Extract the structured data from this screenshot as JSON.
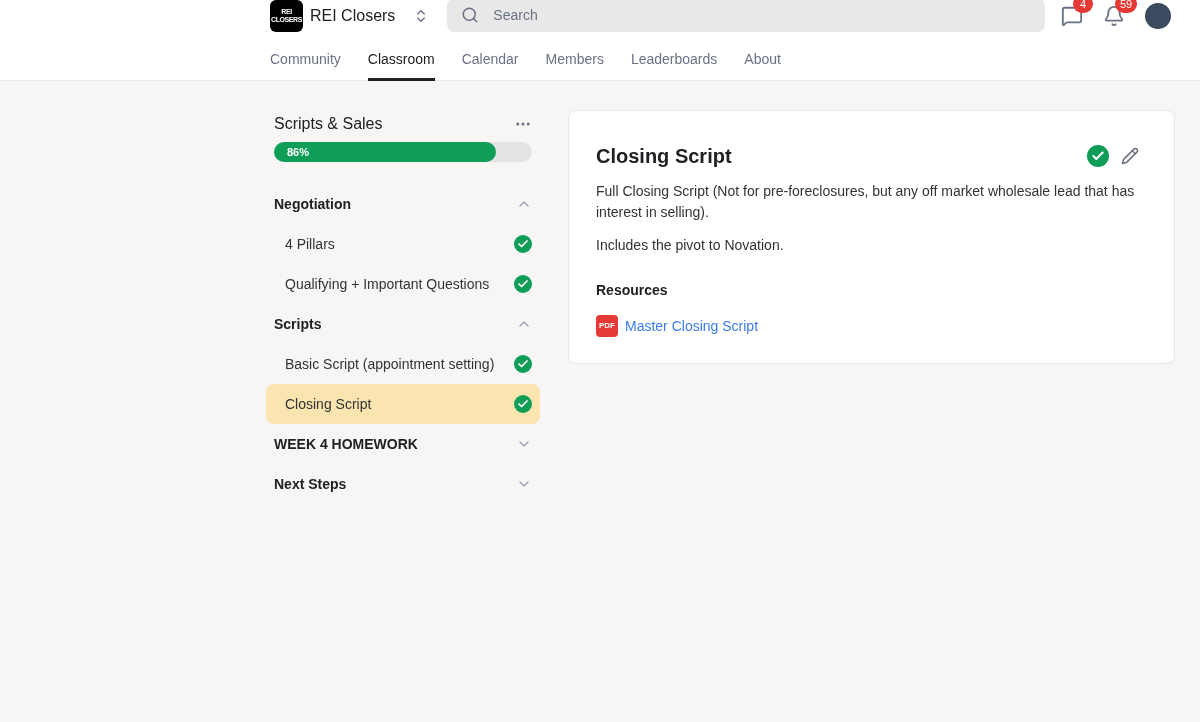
{
  "header": {
    "logo_text": "REI CLOSERS",
    "community_name": "REI Closers",
    "search": {
      "placeholder": "Search"
    },
    "chat_badge": "4",
    "notifications_badge": "59"
  },
  "tabs": [
    {
      "label": "Community",
      "selected": false
    },
    {
      "label": "Classroom",
      "selected": true
    },
    {
      "label": "Calendar",
      "selected": false
    },
    {
      "label": "Members",
      "selected": false
    },
    {
      "label": "Leaderboards",
      "selected": false
    },
    {
      "label": "About",
      "selected": false
    }
  ],
  "sidebar": {
    "title": "Scripts & Sales",
    "progress": {
      "label": "86%",
      "level": 0.86
    },
    "sections": [
      {
        "title": "Negotiation",
        "expanded": true,
        "lessons": [
          {
            "title": "4 Pillars",
            "completed": true,
            "selected": false
          },
          {
            "title": "Qualifying + Important Questions",
            "completed": true,
            "selected": false
          }
        ]
      },
      {
        "title": "Scripts",
        "expanded": true,
        "lessons": [
          {
            "title": "Basic Script (appointment setting)",
            "completed": true,
            "selected": false
          },
          {
            "title": "Closing Script",
            "completed": true,
            "selected": true
          }
        ]
      },
      {
        "title": "WEEK 4 HOMEWORK",
        "expanded": false
      },
      {
        "title": "Next Steps",
        "expanded": false
      }
    ]
  },
  "lesson": {
    "title": "Closing Script",
    "completed": true,
    "paragraphs": [
      "Full Closing Script (Not for pre-foreclosures, but any off market wholesale lead that has interest in selling).",
      "Includes the pivot to Novation."
    ],
    "resources_heading": "Resources",
    "resources": [
      {
        "type_label": "PDF",
        "title": "Master Closing Script"
      }
    ]
  }
}
